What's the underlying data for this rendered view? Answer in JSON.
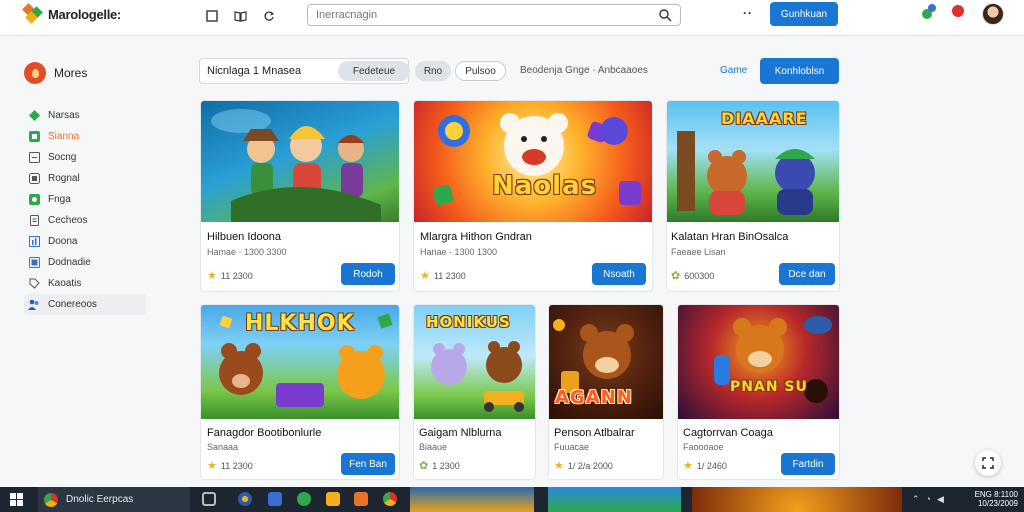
{
  "topbar": {
    "logo_text": "Marologelle:",
    "search_placeholder": "Inerracnagin",
    "search_value": "",
    "more_label": "··",
    "cta_label": "Gunhkuan"
  },
  "sidebar": {
    "title": "Mores",
    "items": [
      {
        "label": "Narsas",
        "icon": "diamond-icon",
        "color": "#2ea84a"
      },
      {
        "label": "Sianna",
        "icon": "grid-icon",
        "color": "#e8732a"
      },
      {
        "label": "Socng",
        "icon": "square-icon",
        "color": "#555555"
      },
      {
        "label": "Rognal",
        "icon": "box-icon",
        "color": "#555555"
      },
      {
        "label": "Fnga",
        "icon": "app-icon",
        "color": "#2ea84a"
      },
      {
        "label": "Cecheos",
        "icon": "doc-icon",
        "color": "#555555"
      },
      {
        "label": "Doona",
        "icon": "bars-icon",
        "color": "#3a6fd0"
      },
      {
        "label": "Dodnadie",
        "icon": "folder-icon",
        "color": "#3a6fd0"
      },
      {
        "label": "Kaoatis",
        "icon": "tag-icon",
        "color": "#555555"
      },
      {
        "label": "Conereoos",
        "icon": "people-icon",
        "color": "#2a5caa"
      }
    ]
  },
  "filters": {
    "input_text": "Nicnlaga 1 Mnasea",
    "chips": [
      "Fedeteue",
      "Rno",
      "Pulsoo"
    ],
    "text": "Beodenja Gnge · Anbcaaoes",
    "link": "Game",
    "cta_label": "Konhloblsn"
  },
  "cards": [
    {
      "title": "Hilbuen Idoona",
      "sub": "Hamae · 1300 3300",
      "rating": "11 2300",
      "button": "Rodoh",
      "art": "Lagoon"
    },
    {
      "title": "Mlargra Hithon Gndran",
      "sub": "Hanae · 1300 1300",
      "rating": "11 2300",
      "button": "Nsoath",
      "art": "Naolas"
    },
    {
      "title": "Kalatan Hran BinOsalca",
      "sub": "Faeaee Lisan",
      "rating": "600300",
      "button": "Dce dan",
      "art": "DIAAARE"
    },
    {
      "title": "Fanagdor Bootibonlurle",
      "sub": "Sanaaa",
      "rating": "11 2300",
      "button": "Fen Ban",
      "art": "HLKHOK"
    },
    {
      "title": "Gaigam Nlblurna",
      "sub": "Biaaue",
      "rating": "1 2300",
      "button": "",
      "art": "HONIKUS"
    },
    {
      "title": "Penson Atlbalrar",
      "sub": "Fuuacae",
      "rating": "1/ 2/a 2000",
      "button": "",
      "art": "AGANN"
    },
    {
      "title": "Cagtorrvan Coaga",
      "sub": "Faoooaoe",
      "rating": "1/ 2460",
      "button": "Fartdin",
      "art": "PNAN SU"
    }
  ],
  "taskbar": {
    "chrome_label": "Dnolic Eerpcas",
    "clock_line1": "ENG 8:1100",
    "clock_line2": "10/23/2009"
  },
  "colors": {
    "accent": "#1976d2",
    "star": "#f2b01e"
  }
}
